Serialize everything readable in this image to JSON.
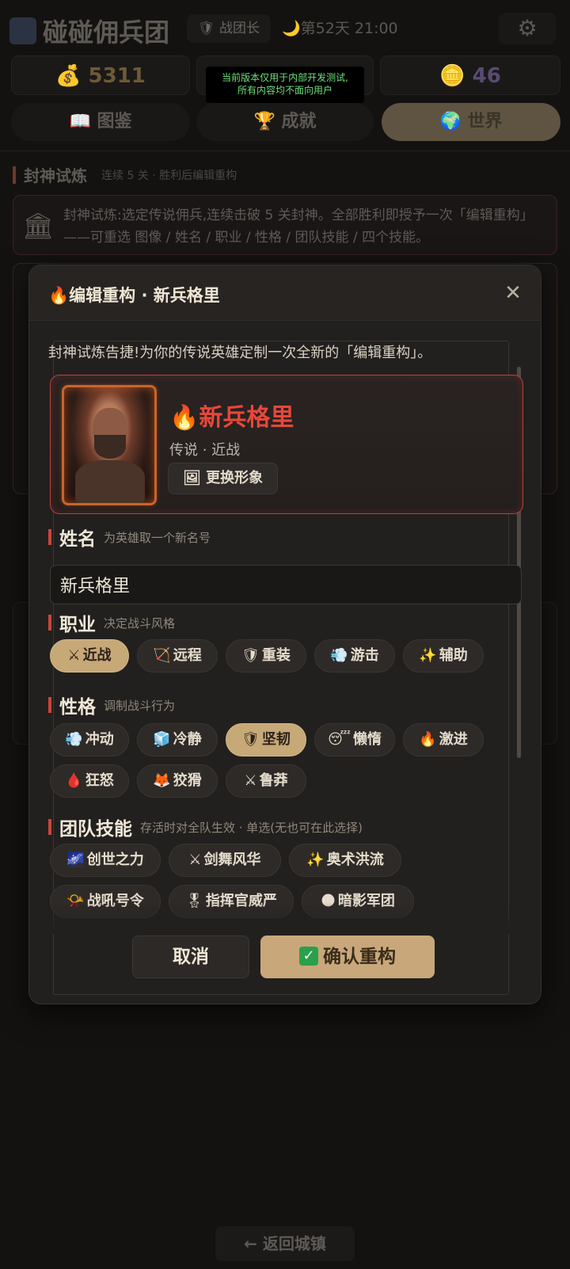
{
  "app": {
    "title": "碰碰佣兵团",
    "rank": "战团长",
    "day": "第52天 21:00",
    "gold": "5311",
    "coins": "46",
    "dev_notice_line1": "当前版本仅用于内部开发测试,",
    "dev_notice_line2": "所有内容均不面向用户"
  },
  "nav": {
    "codex": "图鉴",
    "achievements": "成就",
    "world": "世界"
  },
  "section": {
    "title": "封神试炼",
    "subtitle": "连续 5 关 · 胜利后编辑重构",
    "description": "封神试炼:选定传说佣兵,连续击破 5 关封神。全部胜利即授予一次「编辑重构」——可重选 图像 / 姓名 / 职业 / 性格 / 团队技能 / 四个技能。"
  },
  "return_label": "← 返回城镇",
  "modal": {
    "title": "编辑重构 · 新兵格里",
    "lead": "封神试炼告捷!为你的传说英雄定制一次全新的「编辑重构」。",
    "hero": {
      "name": "新兵格里",
      "meta": "传说 · 近战",
      "change_label": "更换形象"
    },
    "name_section": {
      "label": "姓名",
      "hint": "为英雄取一个新名号",
      "value": "新兵格里"
    },
    "class_section": {
      "label": "职业",
      "hint": "决定战斗风格",
      "options": [
        {
          "icon": "⚔",
          "label": "近战",
          "selected": true
        },
        {
          "icon": "🏹",
          "label": "远程",
          "selected": false
        },
        {
          "icon": "🛡",
          "label": "重装",
          "selected": false
        },
        {
          "icon": "💨",
          "label": "游击",
          "selected": false
        },
        {
          "icon": "✨",
          "label": "辅助",
          "selected": false
        }
      ]
    },
    "personality_section": {
      "label": "性格",
      "hint": "调制战斗行为",
      "options": [
        {
          "icon": "💨",
          "label": "冲动",
          "selected": false
        },
        {
          "icon": "🧊",
          "label": "冷静",
          "selected": false
        },
        {
          "icon": "🛡",
          "label": "坚韧",
          "selected": true
        },
        {
          "icon": "😴",
          "label": "懒惰",
          "selected": false
        },
        {
          "icon": "🔥",
          "label": "激进",
          "selected": false
        },
        {
          "icon": "🩸",
          "label": "狂怒",
          "selected": false
        },
        {
          "icon": "🦊",
          "label": "狡猾",
          "selected": false
        },
        {
          "icon": "⚔",
          "label": "鲁莽",
          "selected": false
        }
      ]
    },
    "team_skill_section": {
      "label": "团队技能",
      "hint": "存活时对全队生效 · 单选(无也可在此选择)",
      "options": [
        {
          "icon": "🌌",
          "label": "创世之力"
        },
        {
          "icon": "⚔",
          "label": "剑舞风华"
        },
        {
          "icon": "✨",
          "label": "奥术洪流"
        },
        {
          "icon": "📯",
          "label": "战吼号令"
        },
        {
          "icon": "🎖",
          "label": "指挥官威严"
        },
        {
          "icon": "🌑",
          "label": "暗影军团"
        }
      ]
    },
    "cancel_label": "取消",
    "confirm_label": "确认重构",
    "colors": {
      "accent_red": "#e8473a",
      "gold": "#c8a87a"
    }
  }
}
